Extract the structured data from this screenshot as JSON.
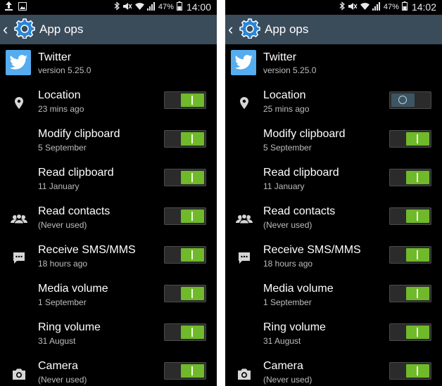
{
  "screens": [
    {
      "status": {
        "battery_percent": "47%",
        "time": "14:00",
        "left_icons": [
          "upload-icon",
          "image-icon"
        ]
      },
      "action_bar": {
        "title": "App ops"
      },
      "app": {
        "name": "Twitter",
        "version": "version 5.25.0"
      },
      "items": [
        {
          "title": "Location",
          "subtitle": "23 mins ago",
          "icon": "location-icon",
          "enabled": true
        },
        {
          "title": "Modify clipboard",
          "subtitle": "5 September",
          "icon": "",
          "enabled": true
        },
        {
          "title": "Read clipboard",
          "subtitle": "11 January",
          "icon": "",
          "enabled": true
        },
        {
          "title": "Read contacts",
          "subtitle": "(Never used)",
          "icon": "contacts-icon",
          "enabled": true
        },
        {
          "title": "Receive SMS/MMS",
          "subtitle": "18 hours ago",
          "icon": "message-icon",
          "enabled": true
        },
        {
          "title": "Media volume",
          "subtitle": "1 September",
          "icon": "",
          "enabled": true
        },
        {
          "title": "Ring volume",
          "subtitle": "31 August",
          "icon": "",
          "enabled": true
        },
        {
          "title": "Camera",
          "subtitle": "(Never used)",
          "icon": "camera-icon",
          "enabled": true
        }
      ]
    },
    {
      "status": {
        "battery_percent": "47%",
        "time": "14:02",
        "left_icons": []
      },
      "action_bar": {
        "title": "App ops"
      },
      "app": {
        "name": "Twitter",
        "version": "version 5.25.0"
      },
      "items": [
        {
          "title": "Location",
          "subtitle": "25 mins ago",
          "icon": "location-icon",
          "enabled": false
        },
        {
          "title": "Modify clipboard",
          "subtitle": "5 September",
          "icon": "",
          "enabled": true
        },
        {
          "title": "Read clipboard",
          "subtitle": "11 January",
          "icon": "",
          "enabled": true
        },
        {
          "title": "Read contacts",
          "subtitle": "(Never used)",
          "icon": "contacts-icon",
          "enabled": true
        },
        {
          "title": "Receive SMS/MMS",
          "subtitle": "18 hours ago",
          "icon": "message-icon",
          "enabled": true
        },
        {
          "title": "Media volume",
          "subtitle": "1 September",
          "icon": "",
          "enabled": true
        },
        {
          "title": "Ring volume",
          "subtitle": "31 August",
          "icon": "",
          "enabled": true
        },
        {
          "title": "Camera",
          "subtitle": "(Never used)",
          "icon": "camera-icon",
          "enabled": true
        }
      ]
    }
  ],
  "colors": {
    "action_bar_bg": "#3a4b5a",
    "toggle_on": "#6fb92a",
    "toggle_off": "#3d5563",
    "twitter_blue": "#55acee"
  }
}
